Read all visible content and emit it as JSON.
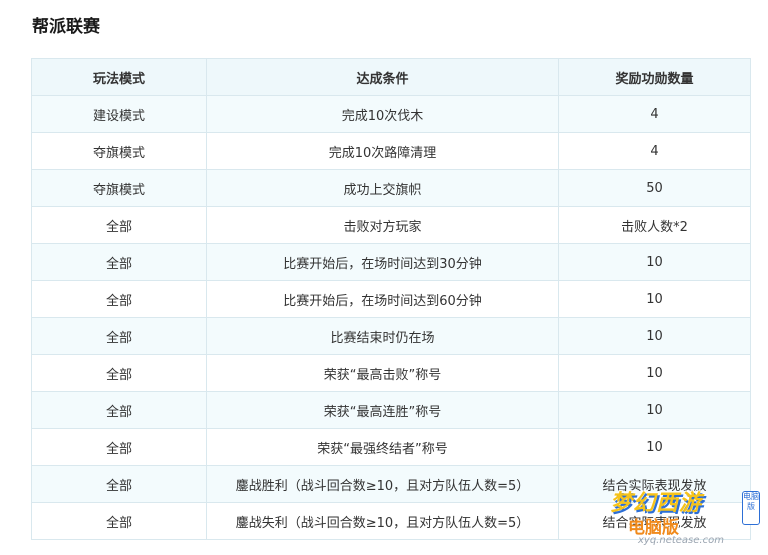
{
  "section": {
    "title": "帮派联赛"
  },
  "table": {
    "headers": [
      "玩法模式",
      "达成条件",
      "奖励功勋数量"
    ],
    "rows": [
      [
        "建设模式",
        "完成10次伐木",
        "4"
      ],
      [
        "夺旗模式",
        "完成10次路障清理",
        "4"
      ],
      [
        "夺旗模式",
        "成功上交旗帜",
        "50"
      ],
      [
        "全部",
        "击败对方玩家",
        "击败人数*2"
      ],
      [
        "全部",
        "比赛开始后，在场时间达到30分钟",
        "10"
      ],
      [
        "全部",
        "比赛开始后，在场时间达到60分钟",
        "10"
      ],
      [
        "全部",
        "比赛结束时仍在场",
        "10"
      ],
      [
        "全部",
        "荣获“最高击败”称号",
        "10"
      ],
      [
        "全部",
        "荣获“最高连胜”称号",
        "10"
      ],
      [
        "全部",
        "荣获“最强终结者”称号",
        "10"
      ],
      [
        "全部",
        "鏖战胜利（战斗回合数≥10，且对方队伍人数=5）",
        "结合实际表现发放"
      ],
      [
        "全部",
        "鏖战失利（战斗回合数≥10，且对方队伍人数=5）",
        "结合实际表现发放"
      ]
    ]
  },
  "watermark": {
    "logo": "梦幻西游",
    "sub": "电脑版",
    "badge": "电脑版",
    "url": "xyq.netease.com"
  }
}
